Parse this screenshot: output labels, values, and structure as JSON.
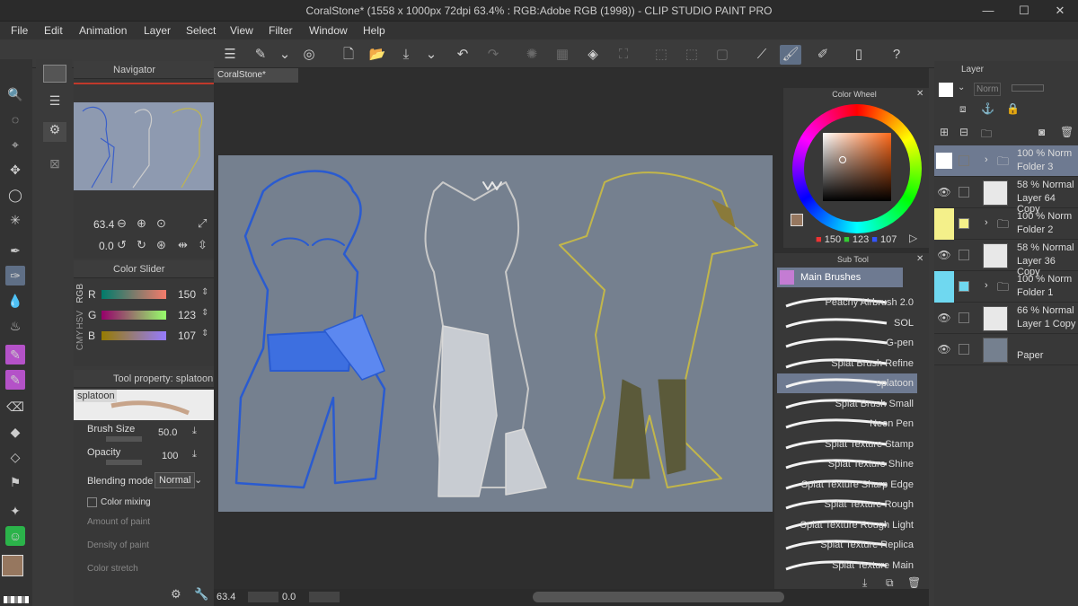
{
  "window": {
    "title": "CoralStone* (1558 x 1000px 72dpi 63.4% : RGB:Adobe RGB (1998)) - CLIP STUDIO PAINT PRO"
  },
  "menu": [
    "File",
    "Edit",
    "Animation",
    "Layer",
    "Select",
    "View",
    "Filter",
    "Window",
    "Help"
  ],
  "colors": {
    "accent": "#6e7a91",
    "canvas_bg": "#75808f",
    "red_line": "#c0392b"
  },
  "navigator": {
    "title": "Navigator",
    "zoom": "63.4",
    "rotation": "0.0"
  },
  "color_slider": {
    "title": "Color Slider",
    "modes": [
      "RGB",
      "HSV",
      "CMY"
    ],
    "channels": [
      {
        "label": "R",
        "value": "150",
        "level": 0.588
      },
      {
        "label": "G",
        "value": "123",
        "level": 0.482
      },
      {
        "label": "B",
        "value": "107",
        "level": 0.42
      }
    ]
  },
  "tool_property": {
    "title": "Tool property: splatoon",
    "brush_name": "splatoon",
    "brush_size_label": "Brush Size",
    "brush_size_value": "50.0",
    "opacity_label": "Opacity",
    "opacity_value": "100",
    "blending_label": "Blending mode",
    "blending_value": "Normal",
    "color_mixing_label": "Color mixing",
    "amount_label": "Amount of paint",
    "density_label": "Density of paint",
    "stretch_label": "Color stretch"
  },
  "document": {
    "tab": "CoralStone*"
  },
  "color_wheel": {
    "title": "Color Wheel",
    "r": "150",
    "g": "123",
    "b": "107"
  },
  "sub_tool": {
    "title": "Sub Tool",
    "group": "Main Brushes",
    "brushes": [
      {
        "name": "Peachy Airbrush 2.0"
      },
      {
        "name": "SOL"
      },
      {
        "name": "G-pen"
      },
      {
        "name": "Splat Brush Refine"
      },
      {
        "name": "splatoon"
      },
      {
        "name": "Splat Brush Small"
      },
      {
        "name": "Neon Pen"
      },
      {
        "name": "Splat Texture Stamp"
      },
      {
        "name": "Splat Texture Shine"
      },
      {
        "name": "Splat Texture Sharp Edge"
      },
      {
        "name": "Splat Texture Rough"
      },
      {
        "name": "Splat Texture Rough Light"
      },
      {
        "name": "Splat Texture Replica"
      },
      {
        "name": "Splat Texture Main"
      }
    ]
  },
  "layer": {
    "title": "Layer",
    "blend_mode": "Norm",
    "rows": [
      {
        "line1": "100 % Norm",
        "line2": "Folder 3",
        "kind": "folder",
        "color": ""
      },
      {
        "line1": "58 % Normal",
        "line2": "Layer 64 Copy",
        "kind": "layer",
        "color": ""
      },
      {
        "line1": "100 % Norm",
        "line2": "Folder 2",
        "kind": "folder",
        "color": "#f4f08a"
      },
      {
        "line1": "58 % Normal",
        "line2": "Layer 36 Copy",
        "kind": "layer",
        "color": ""
      },
      {
        "line1": "100 % Norm",
        "line2": "Folder 1",
        "kind": "folder",
        "color": "#6fd8f0"
      },
      {
        "line1": "66 % Normal",
        "line2": "Layer 1 Copy",
        "kind": "layer",
        "color": ""
      },
      {
        "line1": "",
        "line2": "Paper",
        "kind": "paper",
        "color": ""
      }
    ]
  },
  "status": {
    "zoom": "63.4",
    "rotation": "0.0"
  }
}
